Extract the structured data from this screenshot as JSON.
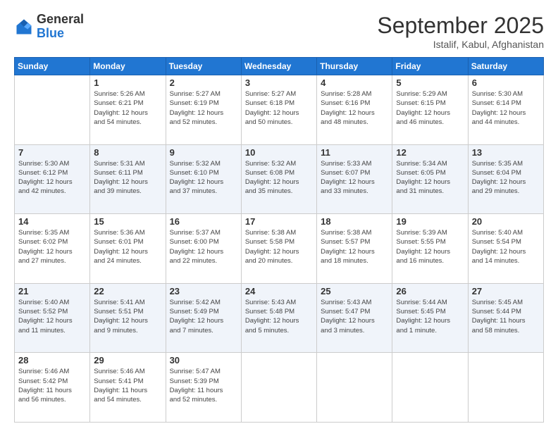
{
  "header": {
    "logo_general": "General",
    "logo_blue": "Blue",
    "month_title": "September 2025",
    "subtitle": "Istalif, Kabul, Afghanistan"
  },
  "weekdays": [
    "Sunday",
    "Monday",
    "Tuesday",
    "Wednesday",
    "Thursday",
    "Friday",
    "Saturday"
  ],
  "weeks": [
    [
      {
        "day": "",
        "info": ""
      },
      {
        "day": "1",
        "info": "Sunrise: 5:26 AM\nSunset: 6:21 PM\nDaylight: 12 hours\nand 54 minutes."
      },
      {
        "day": "2",
        "info": "Sunrise: 5:27 AM\nSunset: 6:19 PM\nDaylight: 12 hours\nand 52 minutes."
      },
      {
        "day": "3",
        "info": "Sunrise: 5:27 AM\nSunset: 6:18 PM\nDaylight: 12 hours\nand 50 minutes."
      },
      {
        "day": "4",
        "info": "Sunrise: 5:28 AM\nSunset: 6:16 PM\nDaylight: 12 hours\nand 48 minutes."
      },
      {
        "day": "5",
        "info": "Sunrise: 5:29 AM\nSunset: 6:15 PM\nDaylight: 12 hours\nand 46 minutes."
      },
      {
        "day": "6",
        "info": "Sunrise: 5:30 AM\nSunset: 6:14 PM\nDaylight: 12 hours\nand 44 minutes."
      }
    ],
    [
      {
        "day": "7",
        "info": "Sunrise: 5:30 AM\nSunset: 6:12 PM\nDaylight: 12 hours\nand 42 minutes."
      },
      {
        "day": "8",
        "info": "Sunrise: 5:31 AM\nSunset: 6:11 PM\nDaylight: 12 hours\nand 39 minutes."
      },
      {
        "day": "9",
        "info": "Sunrise: 5:32 AM\nSunset: 6:10 PM\nDaylight: 12 hours\nand 37 minutes."
      },
      {
        "day": "10",
        "info": "Sunrise: 5:32 AM\nSunset: 6:08 PM\nDaylight: 12 hours\nand 35 minutes."
      },
      {
        "day": "11",
        "info": "Sunrise: 5:33 AM\nSunset: 6:07 PM\nDaylight: 12 hours\nand 33 minutes."
      },
      {
        "day": "12",
        "info": "Sunrise: 5:34 AM\nSunset: 6:05 PM\nDaylight: 12 hours\nand 31 minutes."
      },
      {
        "day": "13",
        "info": "Sunrise: 5:35 AM\nSunset: 6:04 PM\nDaylight: 12 hours\nand 29 minutes."
      }
    ],
    [
      {
        "day": "14",
        "info": "Sunrise: 5:35 AM\nSunset: 6:02 PM\nDaylight: 12 hours\nand 27 minutes."
      },
      {
        "day": "15",
        "info": "Sunrise: 5:36 AM\nSunset: 6:01 PM\nDaylight: 12 hours\nand 24 minutes."
      },
      {
        "day": "16",
        "info": "Sunrise: 5:37 AM\nSunset: 6:00 PM\nDaylight: 12 hours\nand 22 minutes."
      },
      {
        "day": "17",
        "info": "Sunrise: 5:38 AM\nSunset: 5:58 PM\nDaylight: 12 hours\nand 20 minutes."
      },
      {
        "day": "18",
        "info": "Sunrise: 5:38 AM\nSunset: 5:57 PM\nDaylight: 12 hours\nand 18 minutes."
      },
      {
        "day": "19",
        "info": "Sunrise: 5:39 AM\nSunset: 5:55 PM\nDaylight: 12 hours\nand 16 minutes."
      },
      {
        "day": "20",
        "info": "Sunrise: 5:40 AM\nSunset: 5:54 PM\nDaylight: 12 hours\nand 14 minutes."
      }
    ],
    [
      {
        "day": "21",
        "info": "Sunrise: 5:40 AM\nSunset: 5:52 PM\nDaylight: 12 hours\nand 11 minutes."
      },
      {
        "day": "22",
        "info": "Sunrise: 5:41 AM\nSunset: 5:51 PM\nDaylight: 12 hours\nand 9 minutes."
      },
      {
        "day": "23",
        "info": "Sunrise: 5:42 AM\nSunset: 5:49 PM\nDaylight: 12 hours\nand 7 minutes."
      },
      {
        "day": "24",
        "info": "Sunrise: 5:43 AM\nSunset: 5:48 PM\nDaylight: 12 hours\nand 5 minutes."
      },
      {
        "day": "25",
        "info": "Sunrise: 5:43 AM\nSunset: 5:47 PM\nDaylight: 12 hours\nand 3 minutes."
      },
      {
        "day": "26",
        "info": "Sunrise: 5:44 AM\nSunset: 5:45 PM\nDaylight: 12 hours\nand 1 minute."
      },
      {
        "day": "27",
        "info": "Sunrise: 5:45 AM\nSunset: 5:44 PM\nDaylight: 11 hours\nand 58 minutes."
      }
    ],
    [
      {
        "day": "28",
        "info": "Sunrise: 5:46 AM\nSunset: 5:42 PM\nDaylight: 11 hours\nand 56 minutes."
      },
      {
        "day": "29",
        "info": "Sunrise: 5:46 AM\nSunset: 5:41 PM\nDaylight: 11 hours\nand 54 minutes."
      },
      {
        "day": "30",
        "info": "Sunrise: 5:47 AM\nSunset: 5:39 PM\nDaylight: 11 hours\nand 52 minutes."
      },
      {
        "day": "",
        "info": ""
      },
      {
        "day": "",
        "info": ""
      },
      {
        "day": "",
        "info": ""
      },
      {
        "day": "",
        "info": ""
      }
    ]
  ]
}
